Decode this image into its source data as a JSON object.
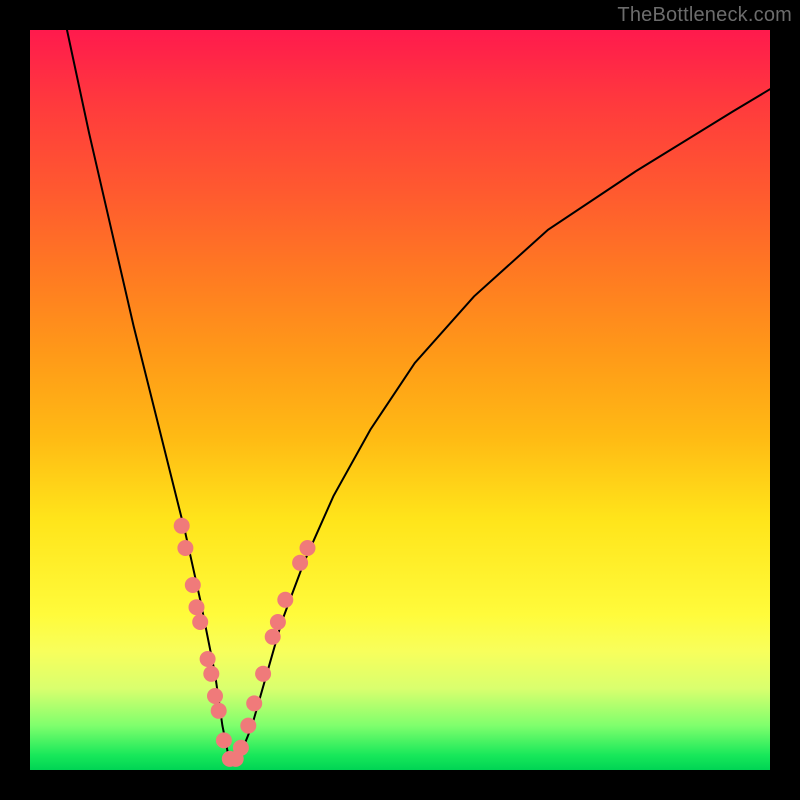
{
  "watermark": "TheBottleneck.com",
  "colors": {
    "dot": "#f07a7a",
    "curve": "#000000",
    "gradient_top": "#ff1a4d",
    "gradient_bottom": "#00d454"
  },
  "chart_data": {
    "type": "line",
    "title": "",
    "xlabel": "",
    "ylabel": "",
    "xlim": [
      0,
      100
    ],
    "ylim": [
      0,
      100
    ],
    "note": "Axes implicit (no ticks). The curve is a V / log-shaped bottleneck curve with minimum near x≈27, y≈0. y=0 at bottom (green), y=100 at top (red). Dots mark sampled datapoints along the curve near the trough.",
    "series": [
      {
        "name": "bottleneck-curve",
        "x": [
          5,
          8,
          11,
          14,
          17,
          19,
          21,
          23,
          25,
          26,
          27,
          28,
          30,
          32,
          34,
          37,
          41,
          46,
          52,
          60,
          70,
          82,
          95,
          100
        ],
        "y": [
          100,
          86,
          73,
          60,
          48,
          40,
          32,
          23,
          13,
          6,
          1,
          1,
          6,
          13,
          20,
          28,
          37,
          46,
          55,
          64,
          73,
          81,
          89,
          92
        ]
      }
    ],
    "datapoints": [
      {
        "x": 20.5,
        "y": 33
      },
      {
        "x": 21.0,
        "y": 30
      },
      {
        "x": 22.0,
        "y": 25
      },
      {
        "x": 22.5,
        "y": 22
      },
      {
        "x": 23.0,
        "y": 20
      },
      {
        "x": 24.0,
        "y": 15
      },
      {
        "x": 24.5,
        "y": 13
      },
      {
        "x": 25.0,
        "y": 10
      },
      {
        "x": 25.5,
        "y": 8
      },
      {
        "x": 26.2,
        "y": 4
      },
      {
        "x": 27.0,
        "y": 1.5
      },
      {
        "x": 27.8,
        "y": 1.5
      },
      {
        "x": 28.5,
        "y": 3
      },
      {
        "x": 29.5,
        "y": 6
      },
      {
        "x": 30.3,
        "y": 9
      },
      {
        "x": 31.5,
        "y": 13
      },
      {
        "x": 32.8,
        "y": 18
      },
      {
        "x": 33.5,
        "y": 20
      },
      {
        "x": 34.5,
        "y": 23
      },
      {
        "x": 36.5,
        "y": 28
      },
      {
        "x": 37.5,
        "y": 30
      }
    ]
  }
}
